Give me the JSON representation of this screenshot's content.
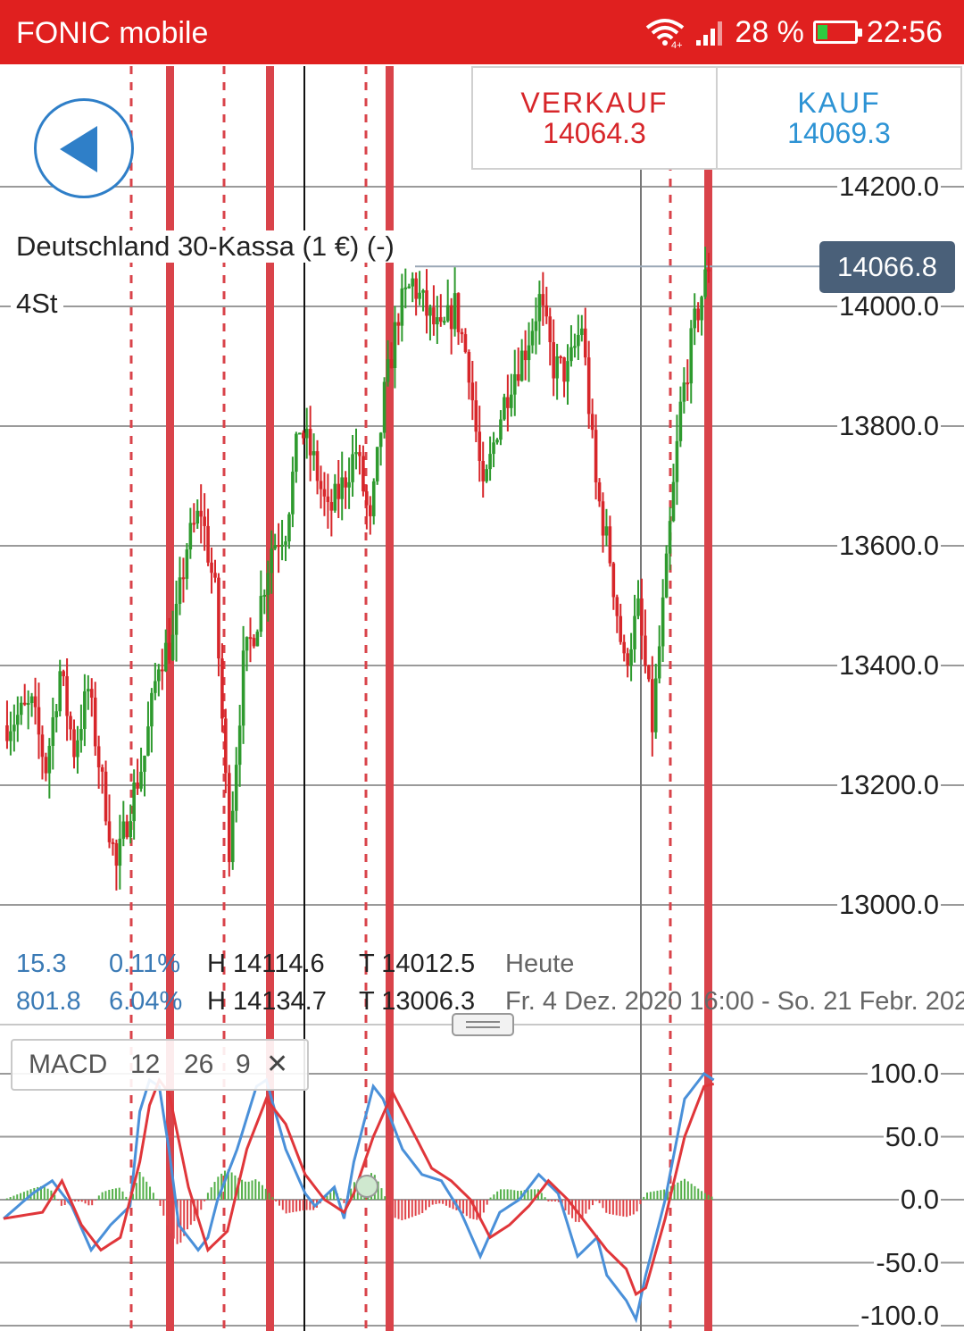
{
  "status_bar": {
    "carrier": "FONIC mobile",
    "battery": "28 %",
    "time": "22:56",
    "wifi_icon": "wifi-icon",
    "signal_icon": "signal-icon",
    "battery_icon": "battery-charging-icon"
  },
  "toolbar": {
    "back_icon": "back-arrow-icon"
  },
  "trade": {
    "sell_label": "VERKAUF",
    "sell_price": "14064.3",
    "buy_label": "KAUF",
    "buy_price": "14069.3"
  },
  "instrument": {
    "name": "Deutschland 30-Kassa (1 €) (-)",
    "timeframe": "4St",
    "current_price": "14066.8"
  },
  "stats": {
    "today": {
      "change": "15.3",
      "change_pct": "0.11%",
      "high": "H 14114.6",
      "low": "T 14012.5",
      "label": "Heute"
    },
    "period": {
      "change": "801.8",
      "change_pct": "6.04%",
      "high": "H 14134.7",
      "low": "T 13006.3",
      "label": "Fr. 4 Dez. 2020 16:00 - So. 21 Febr. 202"
    }
  },
  "indicator": {
    "name": "MACD",
    "p1": "12",
    "p2": "26",
    "p3": "9",
    "close_icon": "close-icon"
  },
  "colors": {
    "up": "#2e9a2e",
    "down": "#d7262a",
    "macd": "#4a90d9",
    "signal": "#e0363a",
    "accent": "#e0201f"
  },
  "chart_data": [
    {
      "type": "candlestick",
      "y_ticks": [
        "14200.0",
        "14000.0",
        "13800.0",
        "13600.0",
        "13400.0",
        "13200.0",
        "13000.0"
      ],
      "ylim": [
        12950,
        14250
      ],
      "current": 14066.8,
      "close_path": [
        [
          0,
          13300
        ],
        [
          4,
          13330
        ],
        [
          6,
          13230
        ],
        [
          8,
          13390
        ],
        [
          10,
          13260
        ],
        [
          12,
          13360
        ],
        [
          14,
          13200
        ],
        [
          16,
          13060
        ],
        [
          18,
          13170
        ],
        [
          20,
          13250
        ],
        [
          22,
          13410
        ],
        [
          24,
          13440
        ],
        [
          26,
          13600
        ],
        [
          28,
          13660
        ],
        [
          30,
          13520
        ],
        [
          32,
          13100
        ],
        [
          34,
          13400
        ],
        [
          36,
          13480
        ],
        [
          38,
          13600
        ],
        [
          40,
          13630
        ],
        [
          42,
          13800
        ],
        [
          44,
          13740
        ],
        [
          46,
          13650
        ],
        [
          48,
          13700
        ],
        [
          50,
          13760
        ],
        [
          52,
          13630
        ],
        [
          54,
          13850
        ],
        [
          56,
          13990
        ],
        [
          58,
          14040
        ],
        [
          60,
          13990
        ],
        [
          62,
          13950
        ],
        [
          64,
          14000
        ],
        [
          66,
          13900
        ],
        [
          68,
          13680
        ],
        [
          70,
          13800
        ],
        [
          72,
          13880
        ],
        [
          74,
          13930
        ],
        [
          76,
          14010
        ],
        [
          78,
          13900
        ],
        [
          80,
          13890
        ],
        [
          82,
          13970
        ],
        [
          84,
          13700
        ],
        [
          86,
          13580
        ],
        [
          88,
          13400
        ],
        [
          90,
          13490
        ],
        [
          92,
          13300
        ],
        [
          94,
          13560
        ],
        [
          96,
          13830
        ],
        [
          98,
          13970
        ],
        [
          100,
          14070
        ]
      ]
    },
    {
      "type": "macd",
      "y_ticks": [
        "100.0",
        "50.0",
        "0.0",
        "-50.0",
        "-100.0"
      ],
      "ylim": [
        -100,
        100
      ],
      "macd": [
        [
          0,
          -15
        ],
        [
          3,
          5
        ],
        [
          5,
          15
        ],
        [
          7,
          -5
        ],
        [
          9,
          -40
        ],
        [
          11,
          -20
        ],
        [
          13,
          -5
        ],
        [
          14,
          70
        ],
        [
          15,
          95
        ],
        [
          16,
          90
        ],
        [
          17,
          40
        ],
        [
          18,
          -20
        ],
        [
          20,
          -40
        ],
        [
          21,
          -30
        ],
        [
          22,
          0
        ],
        [
          24,
          40
        ],
        [
          26,
          90
        ],
        [
          27,
          95
        ],
        [
          29,
          40
        ],
        [
          31,
          5
        ],
        [
          32,
          -5
        ],
        [
          34,
          10
        ],
        [
          35,
          -15
        ],
        [
          36,
          30
        ],
        [
          38,
          90
        ],
        [
          39,
          80
        ],
        [
          41,
          40
        ],
        [
          43,
          20
        ],
        [
          45,
          15
        ],
        [
          47,
          -10
        ],
        [
          49,
          -45
        ],
        [
          51,
          -10
        ],
        [
          53,
          0
        ],
        [
          55,
          20
        ],
        [
          57,
          5
        ],
        [
          59,
          -45
        ],
        [
          61,
          -30
        ],
        [
          62,
          -60
        ],
        [
          64,
          -80
        ],
        [
          65,
          -95
        ],
        [
          66,
          -60
        ],
        [
          68,
          0
        ],
        [
          70,
          80
        ],
        [
          72,
          100
        ],
        [
          73,
          95
        ]
      ],
      "signal": [
        [
          0,
          -15
        ],
        [
          4,
          -10
        ],
        [
          6,
          15
        ],
        [
          8,
          -20
        ],
        [
          10,
          -40
        ],
        [
          12,
          -30
        ],
        [
          14,
          30
        ],
        [
          15,
          75
        ],
        [
          16,
          95
        ],
        [
          17,
          85
        ],
        [
          19,
          10
        ],
        [
          21,
          -40
        ],
        [
          23,
          -25
        ],
        [
          25,
          40
        ],
        [
          27,
          80
        ],
        [
          29,
          60
        ],
        [
          31,
          20
        ],
        [
          33,
          0
        ],
        [
          35,
          -10
        ],
        [
          36,
          5
        ],
        [
          38,
          50
        ],
        [
          40,
          85
        ],
        [
          42,
          55
        ],
        [
          44,
          25
        ],
        [
          46,
          15
        ],
        [
          48,
          0
        ],
        [
          50,
          -30
        ],
        [
          52,
          -20
        ],
        [
          54,
          -5
        ],
        [
          56,
          15
        ],
        [
          58,
          0
        ],
        [
          60,
          -20
        ],
        [
          62,
          -40
        ],
        [
          64,
          -55
        ],
        [
          65,
          -75
        ],
        [
          66,
          -70
        ],
        [
          68,
          -15
        ],
        [
          70,
          50
        ],
        [
          72,
          90
        ],
        [
          73,
          92
        ]
      ]
    }
  ]
}
